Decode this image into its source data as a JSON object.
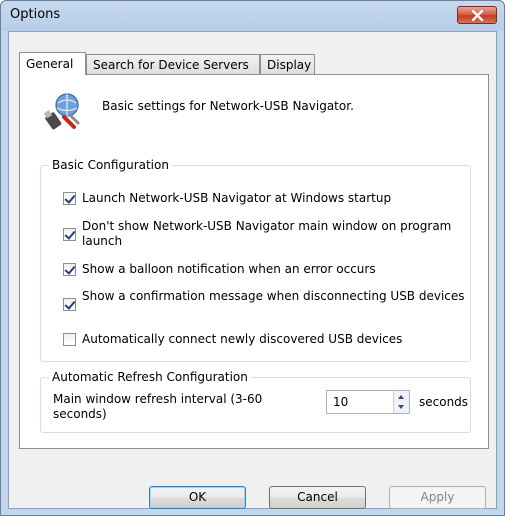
{
  "window": {
    "title": "Options"
  },
  "tabs": [
    {
      "label": "General",
      "active": true
    },
    {
      "label": "Search for Device Servers",
      "active": false
    },
    {
      "label": "Display",
      "active": false
    }
  ],
  "header": {
    "icon": "network-usb-settings-icon",
    "description": "Basic settings for Network-USB Navigator."
  },
  "basic_config": {
    "title": "Basic Configuration",
    "options": [
      {
        "label": "Launch Network-USB Navigator at Windows startup",
        "checked": true
      },
      {
        "label": "Don't show Network-USB Navigator main window on program launch",
        "checked": true
      },
      {
        "label": "Show a balloon notification when an error occurs",
        "checked": true
      },
      {
        "label": "Show a confirmation message when disconnecting USB devices",
        "checked": true
      },
      {
        "label": "Automatically connect newly discovered USB devices",
        "checked": false
      }
    ]
  },
  "refresh_config": {
    "title": "Automatic Refresh Configuration",
    "interval_label": "Main window refresh interval (3-60 seconds)",
    "interval_value": "10",
    "unit": "seconds"
  },
  "buttons": {
    "ok": "OK",
    "cancel": "Cancel",
    "apply": "Apply",
    "apply_enabled": false
  }
}
